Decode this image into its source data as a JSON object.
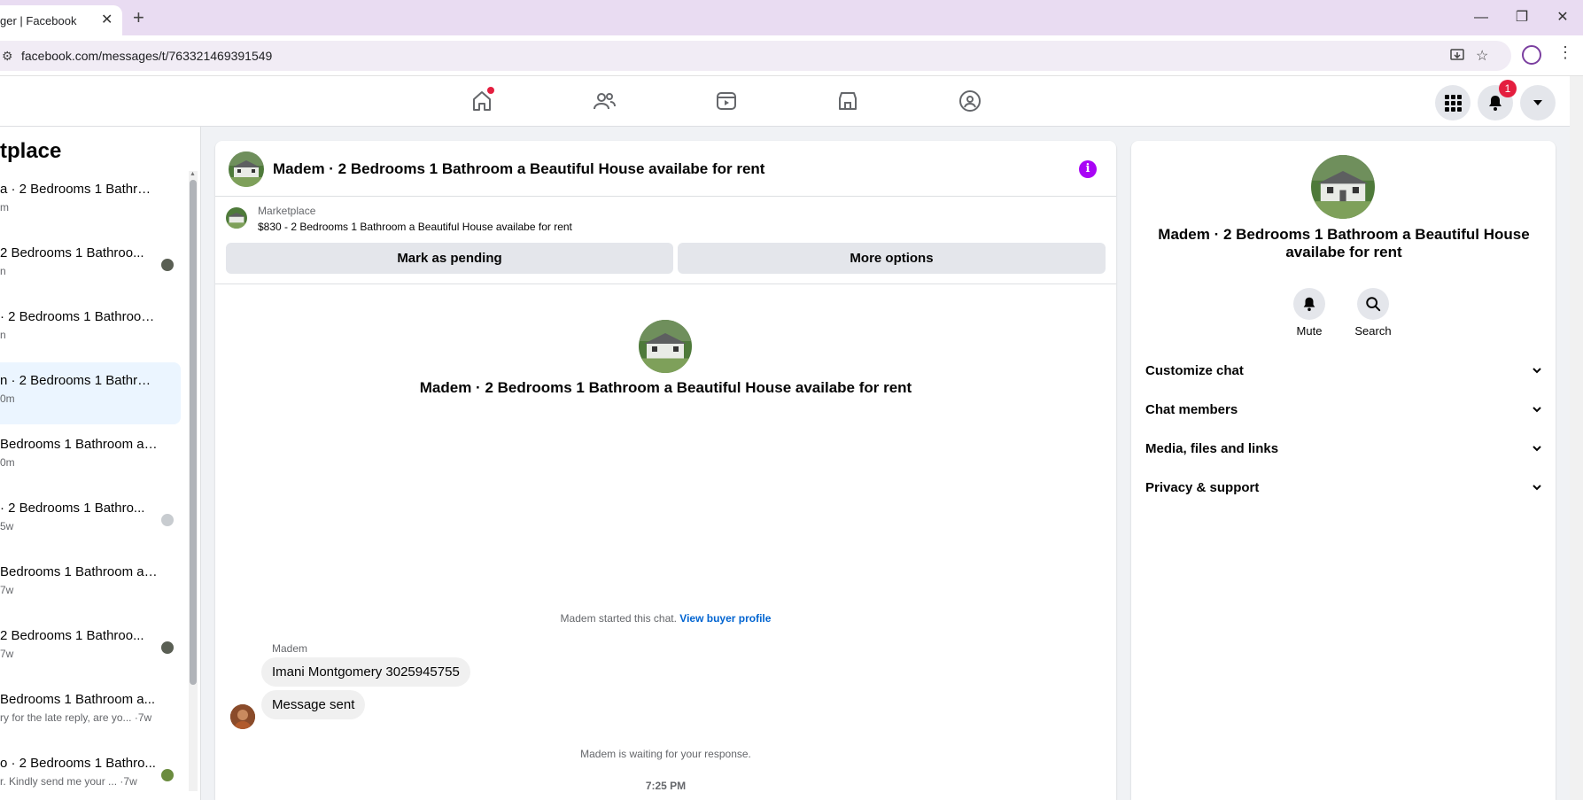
{
  "browser": {
    "tab_title": "ger | Facebook",
    "tab_close": "✕",
    "new_tab": "+",
    "url": "facebook.com/messages/t/763321469391549",
    "win_min": "—",
    "win_restore": "❐",
    "win_close": "✕"
  },
  "fbnav": {
    "notification_count": "1"
  },
  "left": {
    "title": "tplace",
    "conversations": [
      {
        "name": "a · 2 Bedrooms 1 Bathroo...",
        "sub": "m",
        "avatar": "none"
      },
      {
        "name": "2 Bedrooms 1 Bathroo...",
        "sub": "n",
        "avatar": "dark"
      },
      {
        "name": "· 2 Bedrooms 1 Bathroom...",
        "sub": "n",
        "avatar": "none"
      },
      {
        "name": "n · 2 Bedrooms 1 Bathroo...",
        "sub": "0m",
        "avatar": "none",
        "active": true
      },
      {
        "name": "Bedrooms 1 Bathroom a ...",
        "sub": "0m",
        "avatar": "none"
      },
      {
        "name": "· 2 Bedrooms 1 Bathro...",
        "sub": "5w",
        "avatar": "grey"
      },
      {
        "name": "Bedrooms 1 Bathroom a ...",
        "sub": "7w",
        "avatar": "none"
      },
      {
        "name": "2 Bedrooms 1 Bathroo...",
        "sub": "7w",
        "avatar": "dark"
      },
      {
        "name": "Bedrooms 1 Bathroom a...",
        "sub": "ry for the late reply, are yo... ·7w",
        "avatar": "none"
      },
      {
        "name": "o · 2 Bedrooms 1 Bathro...",
        "sub": "r. Kindly send me your ... ·7w",
        "avatar": "green"
      }
    ]
  },
  "chat": {
    "title": "Madem · 2 Bedrooms 1 Bathroom a Beautiful House availabe for rent",
    "info_icon": "i",
    "listing_label": "Marketplace",
    "listing_detail": "$830 - 2 Bedrooms 1 Bathroom a Beautiful House availabe for rent",
    "mark_pending": "Mark as pending",
    "more_options": "More options",
    "center_title": "Madem · 2 Bedrooms 1 Bathroom a Beautiful House availabe for rent",
    "started_text": "Madem started this chat.",
    "view_buyer": "View buyer profile",
    "sender": "Madem",
    "messages": [
      "Imani Montgomery 3025945755",
      "Message sent"
    ],
    "waiting_text": "Madem is waiting for your response.",
    "time": "7:25 PM"
  },
  "right": {
    "title": "Madem · 2 Bedrooms 1 Bathroom a Beautiful House availabe for rent",
    "mute": "Mute",
    "search": "Search",
    "sections": [
      "Customize chat",
      "Chat members",
      "Media, files and links",
      "Privacy & support"
    ]
  },
  "colors": {
    "accent_purple": "#a805f5",
    "link_blue": "#0064d1",
    "badge_red": "#e41e3f",
    "active_row": "#ebf5ff"
  }
}
